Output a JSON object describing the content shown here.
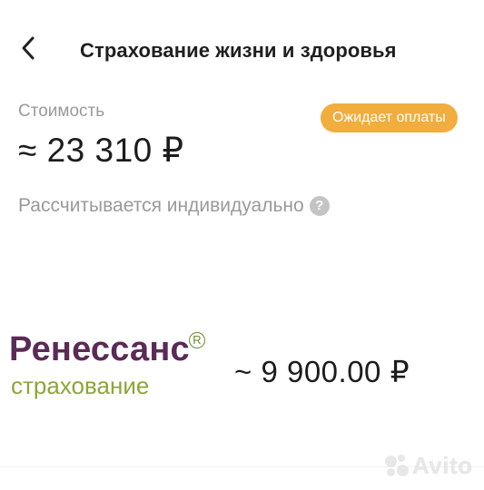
{
  "header": {
    "back_icon": "chevron-left-icon",
    "title": "Страхование жизни и здоровья"
  },
  "cost": {
    "label": "Стоимость",
    "value": "≈ 23 310 ₽",
    "status": "Ожидает оплаты",
    "status_color": "#f1ad3d"
  },
  "calculation": {
    "text": "Рассчитывается индивидуально",
    "help_icon": "question-circle-icon",
    "help_glyph": "?"
  },
  "offer": {
    "logo_name": "Ренессанс",
    "logo_registered": "R",
    "logo_sub": "страхование",
    "logo_main_color": "#5b2a55",
    "logo_sub_color": "#8aa63a",
    "price": "~ 9 900.00 ₽"
  },
  "watermark": {
    "text": "Avito"
  }
}
